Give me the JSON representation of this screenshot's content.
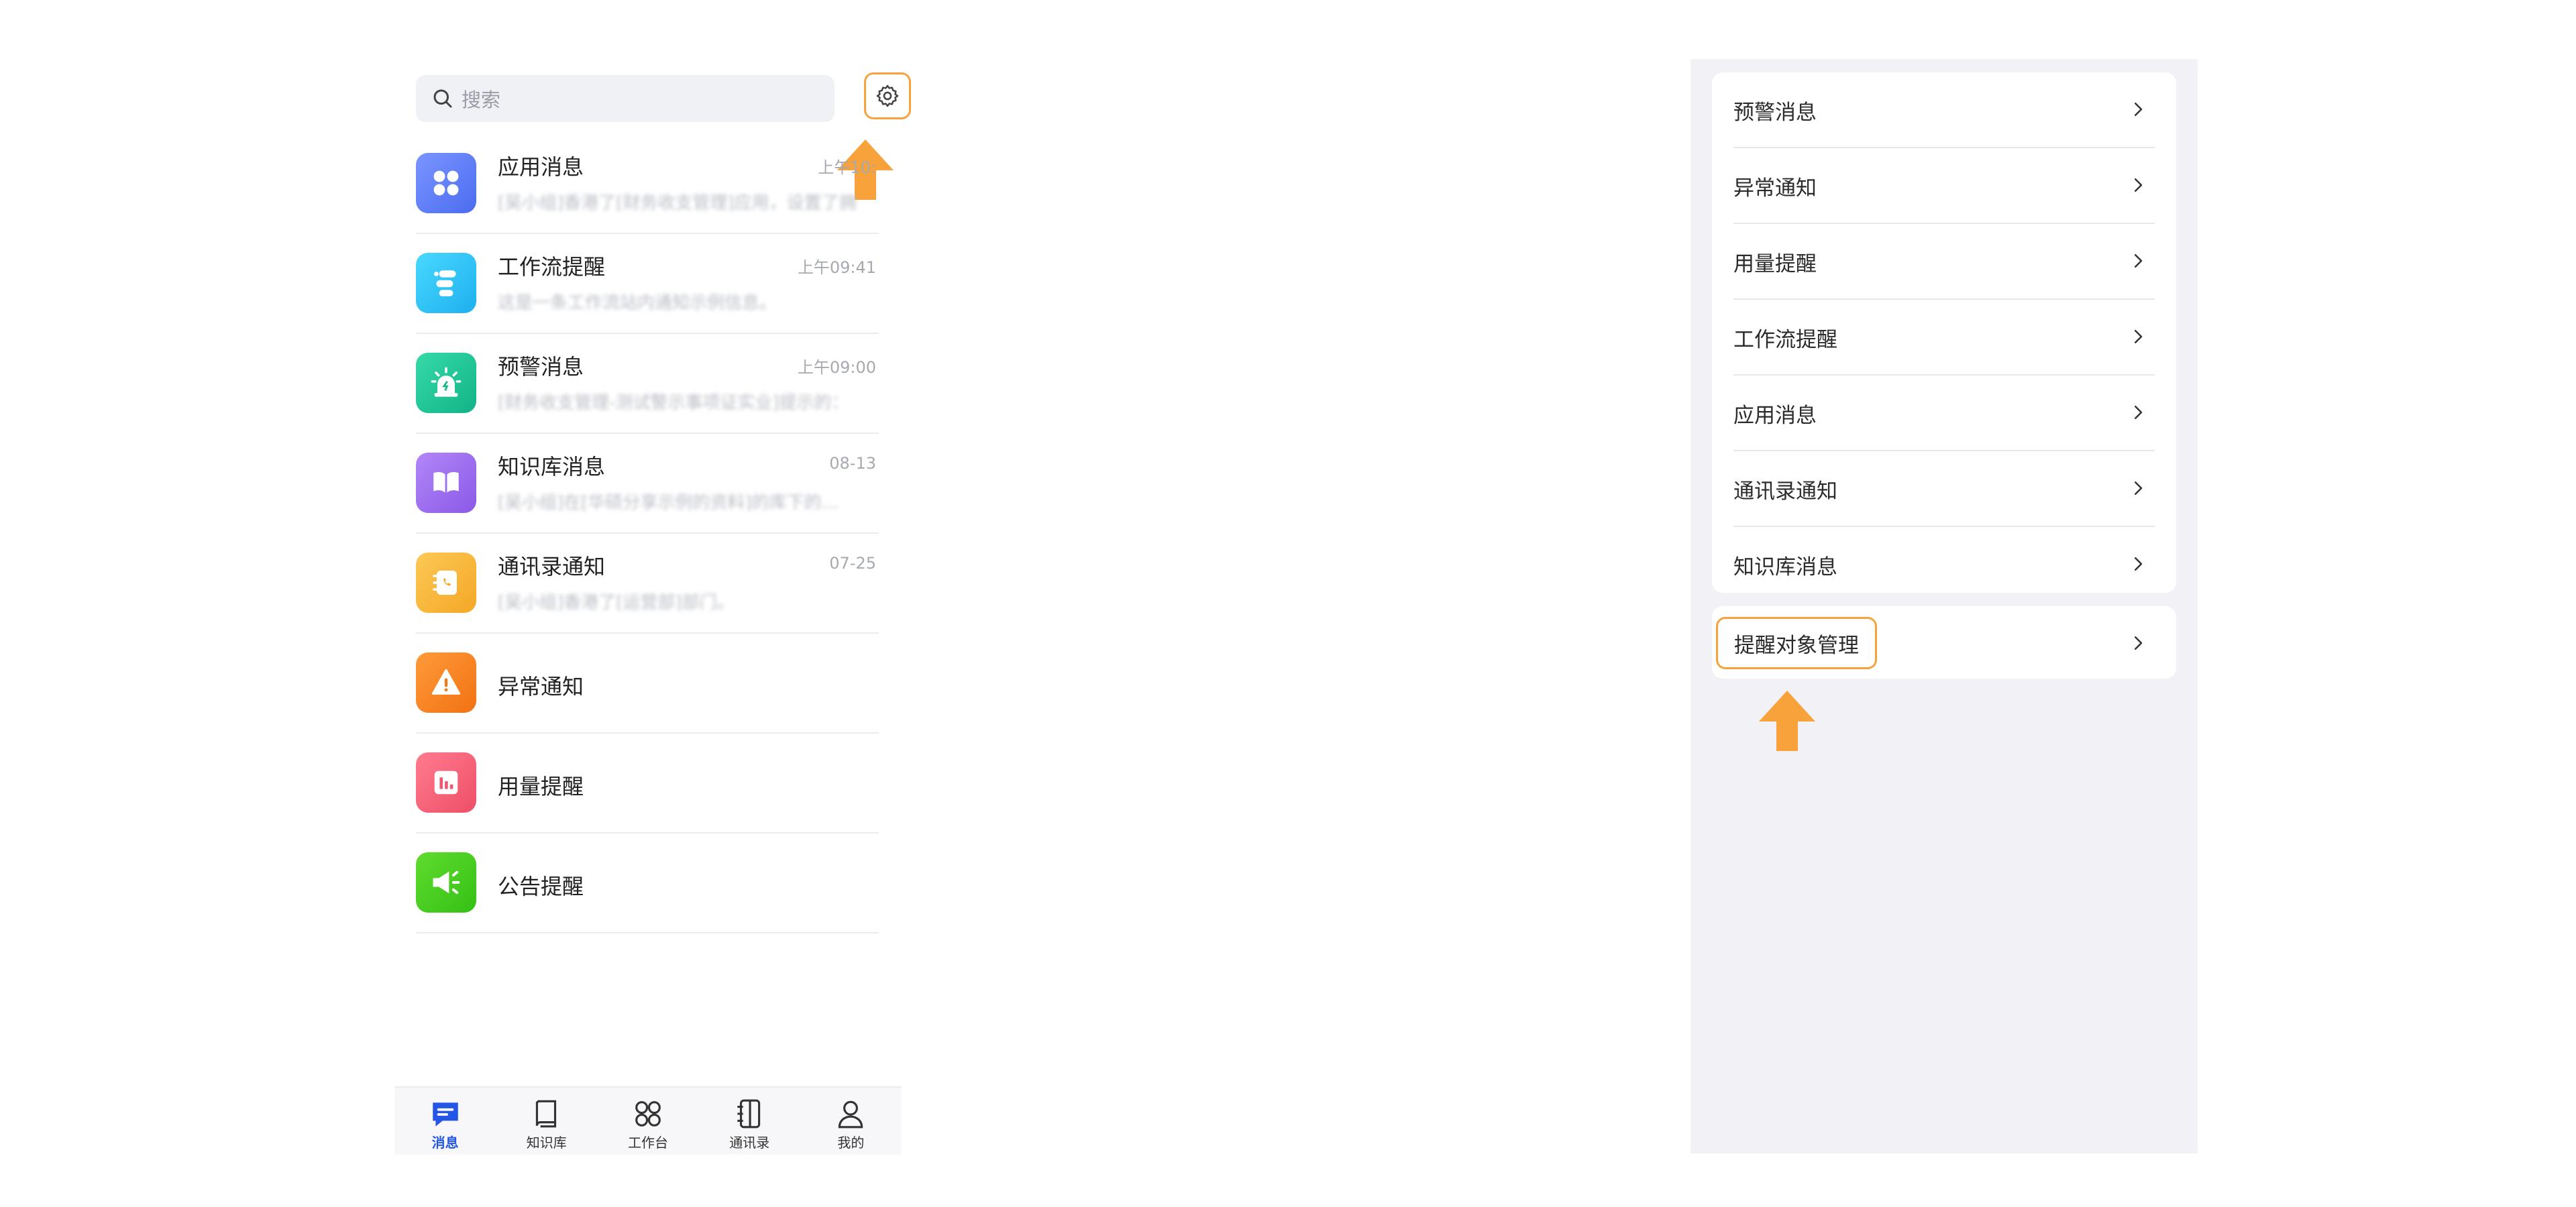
{
  "left_phone": {
    "search": {
      "placeholder": "搜索"
    },
    "messages": [
      {
        "title": "应用消息",
        "time": "上午10:",
        "preview": "[吴小组]香港了[财务收支管理]应用，设置了拥"
      },
      {
        "title": "工作流提醒",
        "time": "上午09:41",
        "preview": "这是一条工作流站内通知示例信息。"
      },
      {
        "title": "预警消息",
        "time": "上午09:00",
        "preview": "[财务收支管理-测试警示事项证实业]提示的："
      },
      {
        "title": "知识库消息",
        "time": "08-13",
        "preview": "[吴小组]在[华硕分享示例的资料]的库下的…"
      },
      {
        "title": "通讯录通知",
        "time": "07-25",
        "preview": "[吴小组]香港了[运营部]部门。"
      },
      {
        "title": "异常通知",
        "time": "",
        "preview": ""
      },
      {
        "title": "用量提醒",
        "time": "",
        "preview": ""
      },
      {
        "title": "公告提醒",
        "time": "",
        "preview": ""
      }
    ],
    "icon_colors": [
      "#5b7cf7",
      "#29c4f0",
      "#1fc59a",
      "#9b6cf2",
      "#f8b93a",
      "#f5821f",
      "#f4607a",
      "#43c71f"
    ],
    "tabs": [
      {
        "label": "消息",
        "icon": "message-icon",
        "active": true
      },
      {
        "label": "知识库",
        "icon": "book-icon",
        "active": false
      },
      {
        "label": "工作台",
        "icon": "grid-icon",
        "active": false
      },
      {
        "label": "通讯录",
        "icon": "contacts-icon",
        "active": false
      },
      {
        "label": "我的",
        "icon": "person-icon",
        "active": false
      }
    ]
  },
  "right_phone": {
    "settings_rows": [
      "预警消息",
      "异常通知",
      "用量提醒",
      "工作流提醒",
      "应用消息",
      "通讯录通知",
      "知识库消息"
    ],
    "manage_row": "提醒对象管理"
  },
  "colors": {
    "accent_orange": "#f7a23b",
    "arrow_orange": "#f7a23b",
    "active_tab": "#2356e6"
  }
}
